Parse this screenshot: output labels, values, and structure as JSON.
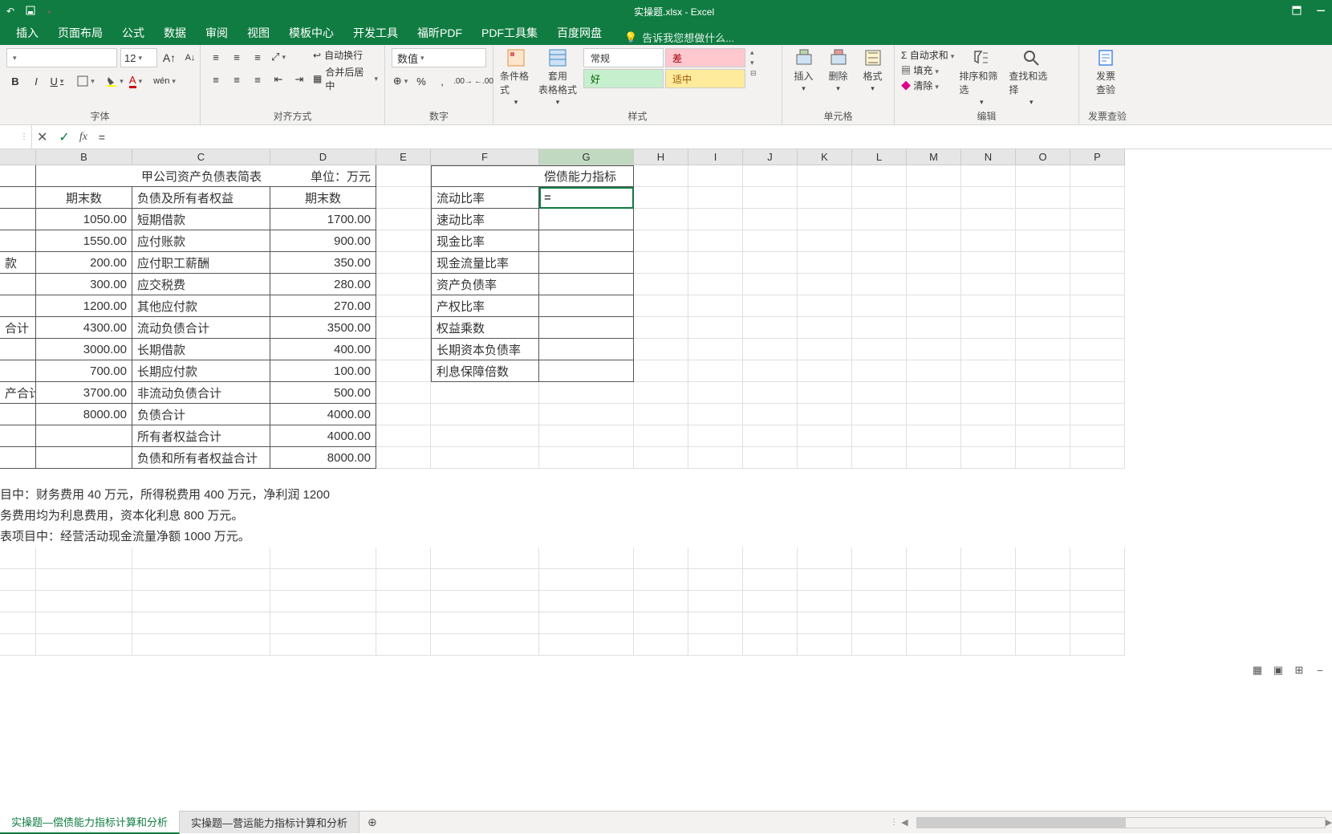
{
  "title_bar": {
    "title": "实操题.xlsx - Excel"
  },
  "tabs": {
    "items": [
      "插入",
      "页面布局",
      "公式",
      "数据",
      "审阅",
      "视图",
      "模板中心",
      "开发工具",
      "福昕PDF",
      "PDF工具集",
      "百度网盘"
    ],
    "tell_me": "告诉我您想做什么..."
  },
  "ribbon": {
    "font": {
      "size": "12",
      "group_label": "字体",
      "bold": "B",
      "italic": "I",
      "underline": "U"
    },
    "align": {
      "group_label": "对齐方式",
      "wrap": "自动换行",
      "merge": "合并后居中"
    },
    "number": {
      "group_label": "数字",
      "format": "数值"
    },
    "styles": {
      "group_label": "样式",
      "cond": "条件格式",
      "table": "套用\n表格格式",
      "normal": "常规",
      "bad": "差",
      "good": "好",
      "neutral": "适中"
    },
    "cells": {
      "group_label": "单元格",
      "insert": "插入",
      "delete": "删除",
      "format": "格式"
    },
    "editing": {
      "group_label": "编辑",
      "autosum": "自动求和",
      "fill": "填充",
      "clear": "清除",
      "sort": "排序和筛选",
      "find": "查找和选择"
    },
    "invoice": {
      "group_label": "发票查验",
      "btn": "发票\n查验"
    }
  },
  "formula_bar": {
    "fx": "fx",
    "value": "="
  },
  "columns": [
    "B",
    "C",
    "D",
    "E",
    "F",
    "G",
    "H",
    "I",
    "J",
    "K",
    "L",
    "M",
    "N",
    "O",
    "P"
  ],
  "table1": {
    "title": "甲公司资产负债表简表",
    "unit": "单位：万元",
    "h_b": "期末数",
    "h_c": "负债及所有者权益",
    "h_d": "期末数",
    "rows": [
      {
        "a": "",
        "b": "1050.00",
        "c": "短期借款",
        "d": "1700.00"
      },
      {
        "a": "",
        "b": "1550.00",
        "c": "应付账款",
        "d": "900.00"
      },
      {
        "a": "款",
        "b": "200.00",
        "c": "应付职工薪酬",
        "d": "350.00"
      },
      {
        "a": "",
        "b": "300.00",
        "c": "应交税费",
        "d": "280.00"
      },
      {
        "a": "",
        "b": "1200.00",
        "c": "其他应付款",
        "d": "270.00"
      },
      {
        "a": "合计",
        "b": "4300.00",
        "c": "流动负债合计",
        "d": "3500.00"
      },
      {
        "a": "",
        "b": "3000.00",
        "c": "长期借款",
        "d": "400.00"
      },
      {
        "a": "",
        "b": "700.00",
        "c": "长期应付款",
        "d": "100.00"
      },
      {
        "a": "产合计",
        "b": "3700.00",
        "c": "非流动负债合计",
        "d": "500.00"
      },
      {
        "a": "",
        "b": "8000.00",
        "c": "负债合计",
        "d": "4000.00"
      },
      {
        "a": "",
        "b": "",
        "c": "所有者权益合计",
        "d": "4000.00"
      },
      {
        "a": "",
        "b": "",
        "c": "负债和所有者权益合计",
        "d": "8000.00"
      }
    ]
  },
  "table2": {
    "title": "偿债能力指标",
    "rows": [
      "流动比率",
      "速动比率",
      "现金比率",
      "现金流量比率",
      "资产负债率",
      "产权比率",
      "权益乘数",
      "长期资本负债率",
      "利息保障倍数"
    ],
    "active_value": "="
  },
  "notes": {
    "l1": "目中：财务费用 40 万元，所得税费用 400 万元，净利润 1200",
    "l2": "务费用均为利息费用，资本化利息 800 万元。",
    "l3": "表项目中：经营活动现金流量净额 1000 万元。"
  },
  "sheet_tabs": {
    "active": "实操题—偿债能力指标计算和分析",
    "other": "实操题—营运能力指标计算和分析"
  }
}
